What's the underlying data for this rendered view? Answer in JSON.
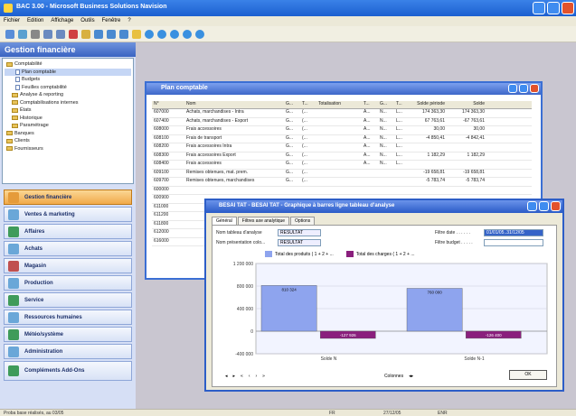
{
  "app": {
    "title": "BAC 3.00 - Microsoft Business Solutions Navision"
  },
  "menu": [
    "Fichier",
    "Edition",
    "Affichage",
    "Outils",
    "Fenêtre",
    "?"
  ],
  "left_panel": {
    "header": "Gestion financière",
    "tree": [
      "Comptabilité",
      "Plan comptable",
      "Budgets",
      "Feuilles comptabilité",
      "Analyse & reporting",
      "Comptabilisations internes",
      "États",
      "Historique",
      "Paramétrage",
      "Banques",
      "Clients",
      "Fournisseurs"
    ],
    "nav": [
      {
        "label": "Gestion financière",
        "color": "#e59b3a"
      },
      {
        "label": "Ventes & marketing",
        "color": "#4a86d0"
      },
      {
        "label": "Affaires",
        "color": "#3f9b5a"
      },
      {
        "label": "Achats",
        "color": "#4a86d0"
      },
      {
        "label": "Magasin",
        "color": "#c05050"
      },
      {
        "label": "Production",
        "color": "#4a86d0"
      },
      {
        "label": "Service",
        "color": "#3f9b5a"
      },
      {
        "label": "Ressources humaines",
        "color": "#4a86d0"
      },
      {
        "label": "Météo/système",
        "color": "#3f9b5a"
      },
      {
        "label": "Administration",
        "color": "#4a86d0"
      },
      {
        "label": "Compléments Add-Ons",
        "color": "#3f9b5a"
      }
    ]
  },
  "window1": {
    "title": "Plan comptable",
    "columns": [
      "N°",
      "Nom",
      "G...",
      "T...",
      "Totalisation",
      "T...",
      "G...",
      "T...",
      "Solde période",
      "Solde"
    ],
    "rows": [
      [
        "607000",
        "Achats, marchandises - Intra",
        "G...",
        "(...",
        "",
        "A...",
        "N...",
        "L...",
        "174 363,30",
        "174 363,30"
      ],
      [
        "607400",
        "Achats, marchandises - Export",
        "G...",
        "(...",
        "",
        "A...",
        "N...",
        "L...",
        "67 763,61",
        "-67 763,61"
      ],
      [
        "608000",
        "Frais accessoires",
        "G...",
        "(...",
        "",
        "A...",
        "N...",
        "L...",
        "30,00",
        "30,00"
      ],
      [
        "608100",
        "Frais de transport",
        "G...",
        "(...",
        "",
        "A...",
        "N...",
        "L...",
        "-4 850,41",
        "-4 842,41"
      ],
      [
        "608200",
        "Frais accessoires Intra",
        "G...",
        "(...",
        "",
        "A...",
        "N...",
        "L...",
        "",
        ""
      ],
      [
        "608300",
        "Frais accessoires Export",
        "G...",
        "(...",
        "",
        "A...",
        "N...",
        "L...",
        "1 182,29",
        "1 182,29"
      ],
      [
        "608400",
        "Frais accessoires",
        "G...",
        "(...",
        "",
        "A...",
        "N...",
        "L...",
        "",
        ""
      ],
      [
        "609100",
        "Remises obtenues, mat. prem.",
        "G...",
        "(...",
        "",
        "",
        "",
        "",
        "-19 658,81",
        "-19 658,81"
      ],
      [
        "609700",
        "Remises obtenues, marchandises",
        "G...",
        "(...",
        "",
        "",
        "",
        "",
        "-5 783,74",
        "-5 783,74"
      ],
      [
        "600000",
        "",
        "",
        "",
        "",
        "",
        "",
        "",
        "",
        ""
      ],
      [
        "600900",
        "",
        "",
        "",
        "",
        "",
        "",
        "",
        "",
        ""
      ],
      [
        "611000",
        "",
        "",
        "",
        "",
        "",
        "",
        "",
        "",
        ""
      ],
      [
        "611200",
        "",
        "",
        "",
        "",
        "",
        "",
        "",
        "",
        ""
      ],
      [
        "611800",
        "",
        "",
        "",
        "",
        "",
        "",
        "",
        "",
        ""
      ],
      [
        "612000",
        "",
        "",
        "",
        "",
        "",
        "",
        "",
        "",
        ""
      ],
      [
        "616000",
        "",
        "",
        "",
        "",
        "",
        "",
        "",
        "",
        ""
      ]
    ]
  },
  "window2": {
    "title": "BESAI TAT - BESAI TAT - Graphique à barres ligne tableau d'analyse",
    "tabs": [
      "Général",
      "Filtres axe analytique",
      "Options"
    ],
    "fields": {
      "name_label": "Nom tableau d'analyse",
      "name_value": "RESULTAT",
      "pres_label": "Nom présentation colo...",
      "pres_value": "RESULTAT",
      "date_filter_label": "Filtre date . . . . . .",
      "date_filter_value": "01/01/05..31/12/05",
      "budget_filter_label": "Filtre budget . . . . ."
    },
    "legend": [
      {
        "label": "Total des produits ( 1 + 2 + ...",
        "color": "#8ea4ee"
      },
      {
        "label": "Total des charges ( 1 + 2 + ...",
        "color": "#8a1f7d"
      }
    ],
    "bottom": {
      "columns_label": "Colonnes"
    },
    "ok_label": "OK"
  },
  "status": {
    "left": "Proba base réalisés, au 03/05",
    "right1": "FR",
    "right2": "27/12/05",
    "right3": "ENR"
  },
  "chart_data": {
    "type": "bar",
    "categories": [
      "Solde N",
      "Solde N-1"
    ],
    "series": [
      {
        "name": "Total des produits ( 1 + 2 + ...",
        "values": [
          810324,
          760000
        ]
      },
      {
        "name": "Total des charges ( 1 + 2 + ...",
        "values": [
          -127926,
          -126400
        ]
      }
    ],
    "data_labels": [
      "810 324",
      "-127 926",
      "760 000",
      "-126 400"
    ],
    "yticks": [
      "1 200 000",
      "800 000",
      "400 000",
      "0",
      "-400 000"
    ],
    "ylim": [
      -400000,
      1200000
    ],
    "grid": true,
    "legend_position": "top"
  }
}
